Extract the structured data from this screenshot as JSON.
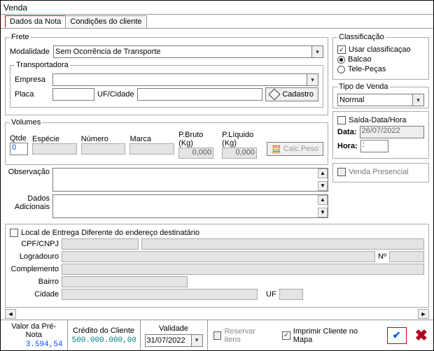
{
  "window": {
    "title": "Venda"
  },
  "tabs": [
    {
      "label": "Dados da Nota",
      "active": true
    },
    {
      "label": "Condições do cliente",
      "active": false
    }
  ],
  "frete": {
    "legend": "Frete",
    "modalidade_label": "Modalidade",
    "modalidade_value": "Sem Ocorrência de Transporte",
    "transportadora": {
      "legend": "Transportadora",
      "empresa_label": "Empresa",
      "empresa_value": "",
      "placa_label": "Placa",
      "placa_value": "",
      "ufcidade_label": "UF/Cidade",
      "cadastro_btn": "Cadastro"
    }
  },
  "volumes": {
    "legend": "Volumes",
    "qtde_label": "Qtde",
    "qtde_value": "0",
    "especie_label": "Espécie",
    "numero_label": "Número",
    "marca_label": "Marca",
    "pbruto_label": "P.Bruto   (Kg)",
    "pbruto_value": "0,000",
    "pliquido_label": "P.Líquido (Kg)",
    "pliquido_value": "0,000",
    "calc_btn": "Calc.Peso"
  },
  "obs": {
    "observacao_label": "Observação",
    "dados_adicionais_label1": "Dados",
    "dados_adicionais_label2": "Adicionais"
  },
  "classificacao": {
    "legend": "Classificação",
    "usar_label": "Usar classificaçao",
    "usar_checked": true,
    "balcao_label": "Balcao",
    "tele_label": "Tele-Peças",
    "selected": "balcao"
  },
  "tipo_venda": {
    "legend": "Tipo de Venda",
    "value": "Normal"
  },
  "saida": {
    "saida_label": "Saída-Data/Hora",
    "saida_checked": false,
    "data_label": "Data:",
    "data_value": "26/07/2022",
    "hora_label": "Hora:",
    "hora_value": ":"
  },
  "presencial": {
    "label": "Venda Presencial",
    "checked": false
  },
  "entrega": {
    "diferente_label": "Local de Entrega Diferente do endereço destinatário",
    "diferente_checked": false,
    "cpf_label": "CPF/CNPJ",
    "logradouro_label": "Logradouro",
    "numero_label": "Nº",
    "complemento_label": "Complemento",
    "bairro_label": "Bairro",
    "cidade_label": "Cidade",
    "uf_label": "UF"
  },
  "footer": {
    "prenota_label": "Valor da Pré-Nota",
    "prenota_value": "3.594,54",
    "credito_label": "Crédito do Cliente",
    "credito_value": "500.000.000,00",
    "validade_label": "Validade",
    "validade_value": "31/07/2022",
    "reservar_label": "Reservar itens",
    "reservar_checked": false,
    "imprimir_label": "Imprimir Cliente no Mapa",
    "imprimir_checked": true
  }
}
